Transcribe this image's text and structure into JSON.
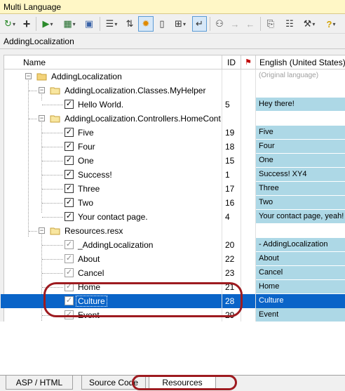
{
  "window": {
    "title": "Multi Language"
  },
  "breadcrumb": "AddingLocalization",
  "toolbar": {
    "icons": [
      "refresh-icon",
      "add-icon",
      "run-icon",
      "table-icon",
      "dialog-icon",
      "outdent-icon",
      "sort-icon",
      "sun-icon",
      "page-icon",
      "grid-icon",
      "return-icon",
      "binoculars-icon",
      "find-next-icon",
      "find-prev-icon",
      "copy-icon",
      "properties-icon",
      "tools-icon",
      "help-icon"
    ]
  },
  "columns": {
    "name": "Name",
    "id": "ID",
    "english": "English (United States)"
  },
  "rows": [
    {
      "name": "AddingLocalization",
      "id": "",
      "english": "(Original language)"
    },
    {
      "name": "AddingLocalization.Classes.MyHelper",
      "id": "",
      "english": ""
    },
    {
      "name": "Hello World.",
      "id": "5",
      "english": "Hey there!"
    },
    {
      "name": "AddingLocalization.Controllers.HomeCont",
      "id": "",
      "english": ""
    },
    {
      "name": "Five",
      "id": "19",
      "english": "Five"
    },
    {
      "name": "Four",
      "id": "18",
      "english": "Four"
    },
    {
      "name": "One",
      "id": "15",
      "english": "One"
    },
    {
      "name": "Success!",
      "id": "1",
      "english": "Success! XY4"
    },
    {
      "name": "Three",
      "id": "17",
      "english": "Three"
    },
    {
      "name": "Two",
      "id": "16",
      "english": "Two"
    },
    {
      "name": "Your contact page.",
      "id": "4",
      "english": "Your contact page, yeah!"
    },
    {
      "name": "Resources.resx",
      "id": "",
      "english": ""
    },
    {
      "name": "_AddingLocalization",
      "id": "20",
      "english": "- AddingLocalization"
    },
    {
      "name": "About",
      "id": "22",
      "english": "About"
    },
    {
      "name": "Cancel",
      "id": "23",
      "english": "Cancel"
    },
    {
      "name": "Home",
      "id": "21",
      "english": "Home"
    },
    {
      "name": "Culture",
      "id": "28",
      "english": "Culture"
    },
    {
      "name": "Event",
      "id": "29",
      "english": "Event"
    }
  ],
  "tabs": [
    "ASP / HTML",
    "Source Code",
    "Resources"
  ],
  "colors": {
    "selection": "#0a64c8",
    "translated": "#add8e6",
    "annotation": "#9e1b20",
    "titlebar": "#fff7c6"
  }
}
